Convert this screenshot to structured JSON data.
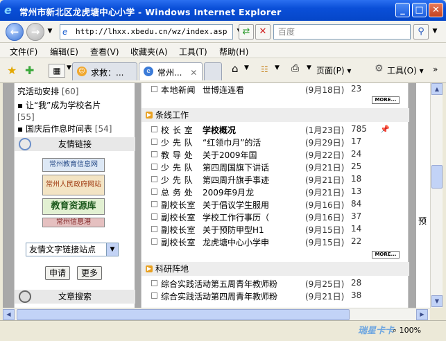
{
  "window": {
    "title": "常州市新北区龙虎塘中心小学 - Windows Internet Explorer",
    "controls": {
      "minimize": "_",
      "maximize": "□",
      "close": "✕"
    }
  },
  "nav": {
    "address": "http://lhxx.xbedu.cn/wz/index.asp",
    "search_placeholder": "百度"
  },
  "menu": {
    "items": [
      "文件(F)",
      "编辑(E)",
      "查看(V)",
      "收藏夹(A)",
      "工具(T)",
      "帮助(H)"
    ]
  },
  "tabs": {
    "items": [
      {
        "label": "求救：...",
        "active": false
      },
      {
        "label": "常州...",
        "active": true
      }
    ],
    "page_label": "页面(P)",
    "tools_label": "工具(O)"
  },
  "sidebar": {
    "announcements": [
      {
        "text": "究活动安排",
        "count": "[60]"
      },
      {
        "text": "让“我”成为学校名片",
        "count": "[55]"
      },
      {
        "text": "国庆后作息时间表",
        "count": "[54]"
      }
    ],
    "links_title": "友情链接",
    "banners": [
      "常州教育信息网",
      "常州人民政府网站",
      "教育资源库",
      "常州信息港"
    ],
    "select_value": "友情文字链接站点",
    "apply_label": "申请",
    "more_label": "更多",
    "article_search_title": "文章搜索"
  },
  "main": {
    "top_row": {
      "cat": "本地新闻",
      "title": "世博连连看",
      "date": "(9月18日)",
      "count": "23"
    },
    "more_label": "MORE...",
    "sections": [
      {
        "title": "条线工作",
        "rows": [
          {
            "cat": "校 长 室",
            "title": "学校概况",
            "date": "(1月23日)",
            "count": "785",
            "pinned": true,
            "bold": true
          },
          {
            "cat": "少 先 队",
            "title": "“红领巾月”的活",
            "date": "(9月29日)",
            "count": "17"
          },
          {
            "cat": "教 导 处",
            "title": "关于2009年国",
            "date": "(9月22日)",
            "count": "24"
          },
          {
            "cat": "少 先 队",
            "title": "第四周国旗下讲话",
            "date": "(9月21日)",
            "count": "25"
          },
          {
            "cat": "少 先 队",
            "title": "第四周升旗手事迹",
            "date": "(9月21日)",
            "count": "18"
          },
          {
            "cat": "总 务 处",
            "title": "2009年9月龙",
            "date": "(9月21日)",
            "count": "13"
          },
          {
            "cat": "副校长室",
            "title": "关于倡议学生服用",
            "date": "(9月16日)",
            "count": "84"
          },
          {
            "cat": "副校长室",
            "title": "学校工作行事历（",
            "date": "(9月16日)",
            "count": "37"
          },
          {
            "cat": "副校长室",
            "title": "关于预防甲型H1",
            "date": "(9月15日)",
            "count": "14"
          },
          {
            "cat": "副校长室",
            "title": "龙虎塘中心小学申",
            "date": "(9月15日)",
            "count": "22"
          }
        ]
      },
      {
        "title": "科研阵地",
        "rows": [
          {
            "cat": "综合实践活动",
            "title": "第五周青年教师粉",
            "date": "(9月25日)",
            "count": "28"
          },
          {
            "cat": "综合实践活动",
            "title": "第四周青年教师粉",
            "date": "(9月21日)",
            "count": "38"
          }
        ]
      }
    ]
  },
  "right_edge": {
    "text": "预"
  },
  "status": {
    "zoom": "100%",
    "watermark": "瑞星卡卡"
  }
}
